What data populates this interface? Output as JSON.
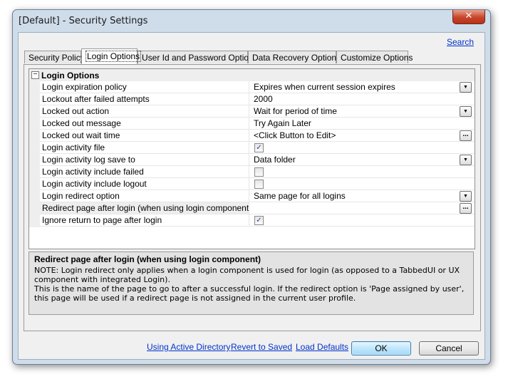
{
  "window": {
    "title": "[Default] - Security Settings",
    "close_glyph": "✕"
  },
  "search_link": "Search",
  "tabs": [
    {
      "label": "Security Policy",
      "active": false
    },
    {
      "label": "Login Options",
      "active": true
    },
    {
      "label": "User Id and Password Options",
      "active": false
    },
    {
      "label": "Data Recovery Options",
      "active": false
    },
    {
      "label": "Customize Options",
      "active": false
    }
  ],
  "grid": {
    "category": "Login Options",
    "collapse_glyph": "−",
    "rows": [
      {
        "name": "Login expiration policy",
        "value": "Expires when current session expires",
        "editor": "dropdown"
      },
      {
        "name": "Lockout after failed attempts",
        "value": "2000",
        "editor": "text"
      },
      {
        "name": "Locked out action",
        "value": "Wait for period of time",
        "editor": "dropdown"
      },
      {
        "name": "Locked out message",
        "value": "Try Again Later",
        "editor": "text"
      },
      {
        "name": "Locked out wait time",
        "value": "<Click Button to Edit>",
        "editor": "ellipsis"
      },
      {
        "name": "Login activity file",
        "checked": true,
        "editor": "checkbox"
      },
      {
        "name": "Login activity log save to",
        "value": "Data folder",
        "editor": "dropdown"
      },
      {
        "name": "Login activity include failed",
        "checked": false,
        "editor": "checkbox"
      },
      {
        "name": "Login activity include logout",
        "checked": false,
        "editor": "checkbox"
      },
      {
        "name": "Login redirect option",
        "value": "Same page for all logins",
        "editor": "dropdown"
      },
      {
        "name": "Redirect page after login (when using login component)",
        "value": "",
        "editor": "ellipsis",
        "selected": true
      },
      {
        "name": "Ignore return to page after login",
        "checked": true,
        "editor": "checkbox"
      }
    ]
  },
  "description": {
    "title": "Redirect page after login (when using login component)",
    "lines": [
      "NOTE: Login redirect only applies when a login component is used for login (as opposed to a TabbedUI or UX component with integrated Login).",
      "This is the name of the page to go to after a successful login. If the redirect option is 'Page assigned by user', this page will be used if a redirect page is not assigned in the current user profile."
    ]
  },
  "footer": {
    "links": [
      "Using Active Directory",
      "Revert to Saved",
      "Load Defaults"
    ],
    "ok_label": "OK",
    "cancel_label": "Cancel"
  },
  "icons": {
    "dropdown": "▼",
    "ellipsis": "...",
    "check": "✓"
  },
  "colors": {
    "link": "#0033cc",
    "close_button": "#c8452c",
    "checkmark": "#2a3f9a"
  }
}
